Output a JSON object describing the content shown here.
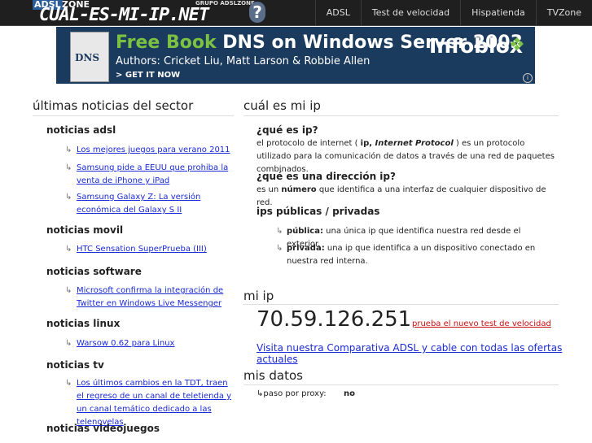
{
  "logo": {
    "adsl": "ADSL",
    "zone": "ZONE",
    "grupo": "GRUPO ADSLZONE",
    "main": "CUAL-ES-MI-IP.NET",
    "q": "?"
  },
  "nav": [
    "ADSL",
    "Test de velocidad",
    "Hispatienda",
    "TVZone"
  ],
  "banner": {
    "title_green": "Free Book",
    "title_white": "DNS on Windows Server 2003",
    "authors": "Authors: Cricket Liu, Matt Larson & Robbie Allen",
    "cta": "> GET IT NOW",
    "brand": "Infoblox",
    "book_label": "DNS"
  },
  "left": {
    "heading": "últimas noticias del sector",
    "sections": [
      {
        "title": "noticias adsl",
        "items": [
          "Los mejores juegos para verano 2011",
          "Samsung pide a EEUU que prohiba la venta de iPhone y iPad",
          "Samsung Galaxy Z: La versión económica del Galaxy S II"
        ]
      },
      {
        "title": "noticias movil",
        "items": [
          "HTC Sensation SuperPrueba (III)"
        ]
      },
      {
        "title": "noticias software",
        "items": [
          "Microsoft confirma la integración de Twitter en Windows Live Messenger"
        ]
      },
      {
        "title": "noticias linux",
        "items": [
          "Warsow 0.62 para Linux"
        ]
      },
      {
        "title": "noticias tv",
        "items": [
          "Los últimos cambios en la TDT, traen el regreso de un canal de teletienda y un canal temático dedicado a las telenovelas"
        ]
      },
      {
        "title": "noticias videojuegos",
        "items": []
      }
    ]
  },
  "right": {
    "heading": "cuál es mi ip",
    "q1": "¿qué es ip?",
    "a1_pre": "el protocolo de internet ( ",
    "a1_b1": "ip, ",
    "a1_b2": "Internet Protocol",
    "a1_post": " ) es un protocolo utilizado para la comunicación de datos a través de una red de paquetes combinados.",
    "q2": "¿qué es una dirección ip?",
    "a2_pre": "es un ",
    "a2_b": "número",
    "a2_post": " que identifica a una interfaz de cualquier dispositivo de red.",
    "q3": "ips públicas / privadas",
    "pub_label": "pública:",
    "pub_text": " una única ip que identifica nuestra red desde el exterior.",
    "priv_label": "privada:",
    "priv_text": " una ip que identifica a un dispositivo conectado en nuestra red interna.",
    "myip_heading": "mi ip",
    "ip": "70.59.126.251",
    "speed_link": "prueba el nuevo test de velocidad",
    "compare_link": "Visita nuestra Comparativa ADSL y cable con todas las ofertas actuales",
    "data_heading": "mis datos",
    "proxy_label": "paso por proxy:",
    "proxy_value": "no",
    "bullet": "↳"
  }
}
